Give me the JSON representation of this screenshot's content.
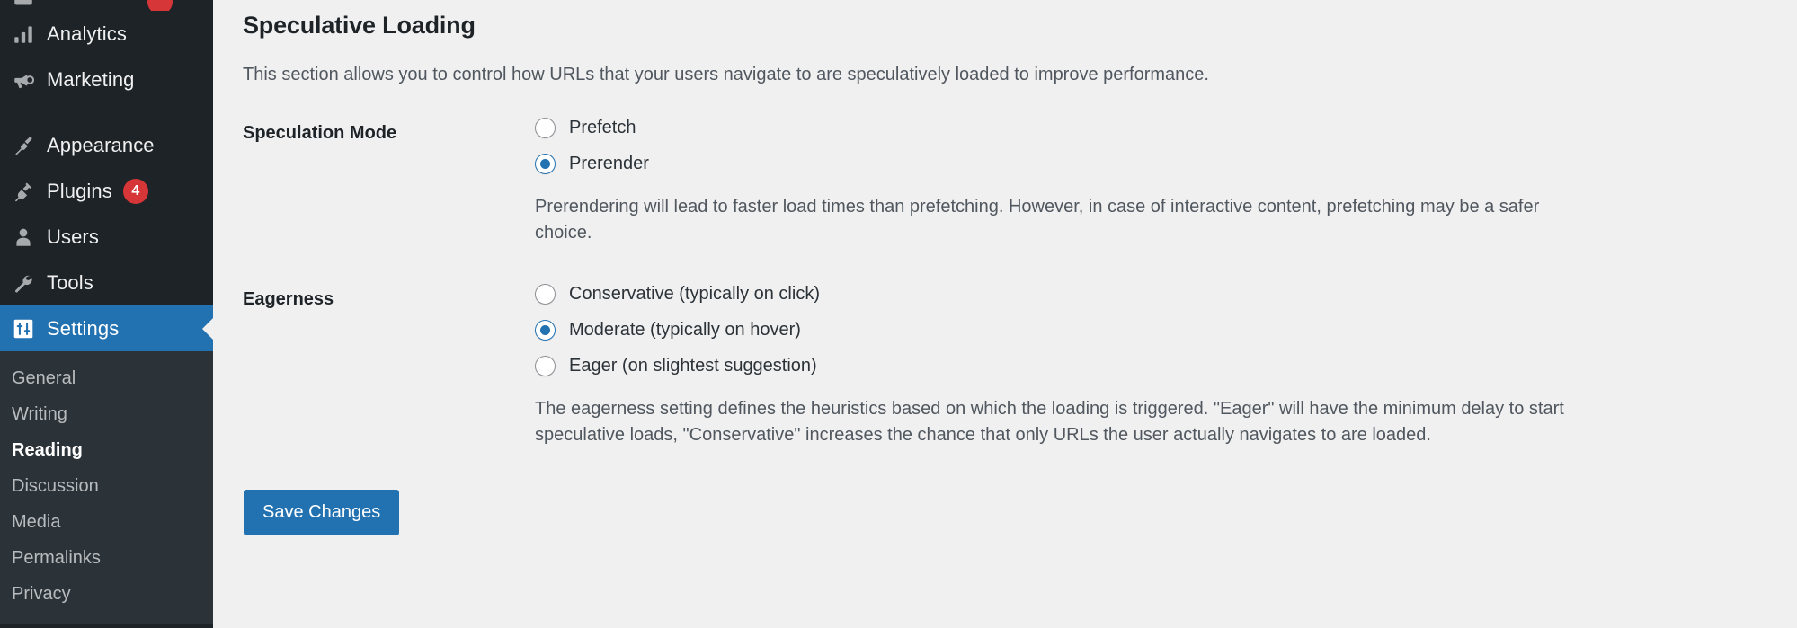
{
  "sidebar": {
    "clipped_top_item": {
      "label": "",
      "badge": ""
    },
    "items": [
      {
        "label": "Analytics",
        "icon": "chart-bar-icon",
        "badge": ""
      },
      {
        "label": "Marketing",
        "icon": "megaphone-icon",
        "badge": ""
      },
      {
        "label": "Appearance",
        "icon": "paintbrush-icon",
        "badge": ""
      },
      {
        "label": "Plugins",
        "icon": "plug-icon",
        "badge": "4"
      },
      {
        "label": "Users",
        "icon": "user-icon",
        "badge": ""
      },
      {
        "label": "Tools",
        "icon": "wrench-icon",
        "badge": ""
      },
      {
        "label": "Settings",
        "icon": "sliders-icon",
        "badge": ""
      }
    ],
    "submenu": [
      {
        "label": "General",
        "current": false
      },
      {
        "label": "Writing",
        "current": false
      },
      {
        "label": "Reading",
        "current": true
      },
      {
        "label": "Discussion",
        "current": false
      },
      {
        "label": "Media",
        "current": false
      },
      {
        "label": "Permalinks",
        "current": false
      },
      {
        "label": "Privacy",
        "current": false
      }
    ]
  },
  "main": {
    "title": "Speculative Loading",
    "description": "This section allows you to control how URLs that your users navigate to are speculatively loaded to improve performance.",
    "speculation_mode": {
      "label": "Speculation Mode",
      "options": [
        {
          "label": "Prefetch",
          "checked": false
        },
        {
          "label": "Prerender",
          "checked": true
        }
      ],
      "help": "Prerendering will lead to faster load times than prefetching. However, in case of interactive content, prefetching may be a safer choice."
    },
    "eagerness": {
      "label": "Eagerness",
      "options": [
        {
          "label": "Conservative (typically on click)",
          "checked": false
        },
        {
          "label": "Moderate (typically on hover)",
          "checked": true
        },
        {
          "label": "Eager (on slightest suggestion)",
          "checked": false
        }
      ],
      "help": "The eagerness setting defines the heuristics based on which the loading is triggered. \"Eager\" will have the minimum delay to start speculative loads, \"Conservative\" increases the chance that only URLs the user actually navigates to are loaded."
    },
    "save_label": "Save Changes"
  },
  "colors": {
    "sidebar_bg": "#1d2327",
    "submenu_bg": "#2c3338",
    "accent": "#2271b1",
    "badge": "#d63638",
    "content_bg": "#f0f0f1"
  }
}
